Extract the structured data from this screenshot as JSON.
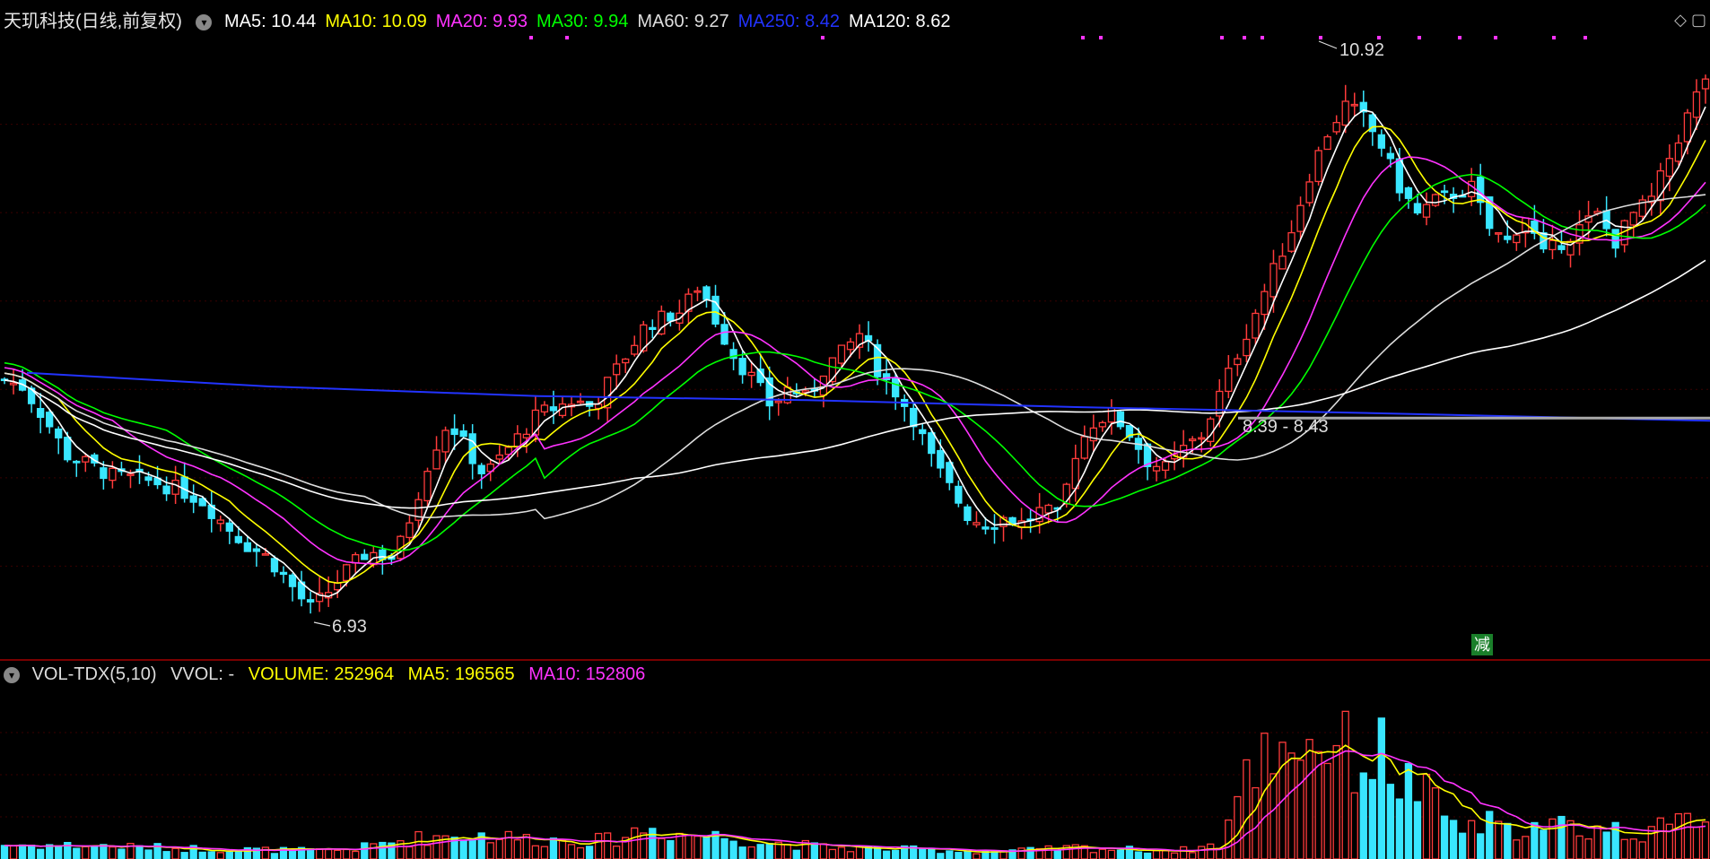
{
  "header": {
    "stock_title": "天玑科技(日线,前复权)",
    "ma_legend": [
      {
        "label": "MA5: 10.44",
        "color": "#ffffff"
      },
      {
        "label": "MA10: 10.09",
        "color": "#ffff00"
      },
      {
        "label": "MA20: 9.93",
        "color": "#ff33ff"
      },
      {
        "label": "MA30: 9.94",
        "color": "#00ff00"
      },
      {
        "label": "MA60: 9.27",
        "color": "#dddddd"
      },
      {
        "label": "MA250: 8.42",
        "color": "#2233ff"
      },
      {
        "label": "MA120: 8.62",
        "color": "#ffffff"
      }
    ]
  },
  "vol_header": {
    "indicator": "VOL-TDX(5,10)",
    "vvol": "VVOL: -",
    "volume": "VOLUME: 252964",
    "ma5": "MA5: 196565",
    "ma10": "MA10: 152806",
    "colors": {
      "indicator": "#dddddd",
      "volume": "#ffff00",
      "ma5": "#ffff00",
      "ma10": "#ff33ff"
    }
  },
  "annotations": {
    "high": "10.92",
    "low": "6.93",
    "range": "8.39 - 8.43",
    "badge": "减"
  },
  "colors": {
    "up": "#ff3b3b",
    "down": "#39e6ff",
    "ma5": "#ffffff",
    "ma10": "#ffff00",
    "ma20": "#ff33ff",
    "ma30": "#00ff00",
    "ma60": "#dddddd",
    "ma250": "#2233ff",
    "ma120": "#ffffff"
  },
  "chart_data": {
    "type": "candlestick",
    "y_range_price": [
      6.6,
      11.1
    ],
    "price_points": [
      [
        0,
        8.61
      ],
      [
        25,
        8.55
      ],
      [
        50,
        8.32
      ],
      [
        75,
        8.05
      ],
      [
        100,
        7.98
      ],
      [
        125,
        7.9
      ],
      [
        150,
        7.88
      ],
      [
        175,
        7.85
      ],
      [
        200,
        7.8
      ],
      [
        225,
        7.72
      ],
      [
        250,
        7.55
      ],
      [
        275,
        7.4
      ],
      [
        300,
        7.3
      ],
      [
        325,
        7.1
      ],
      [
        345,
        6.93
      ],
      [
        365,
        7.05
      ],
      [
        385,
        7.2
      ],
      [
        410,
        7.35
      ],
      [
        440,
        7.3
      ],
      [
        460,
        7.65
      ],
      [
        480,
        8.05
      ],
      [
        500,
        8.3
      ],
      [
        520,
        8.1
      ],
      [
        540,
        7.9
      ],
      [
        560,
        8.05
      ],
      [
        580,
        8.2
      ],
      [
        600,
        8.35
      ],
      [
        620,
        8.4
      ],
      [
        640,
        8.45
      ],
      [
        660,
        8.4
      ],
      [
        680,
        8.6
      ],
      [
        700,
        8.8
      ],
      [
        720,
        9.0
      ],
      [
        740,
        9.05
      ],
      [
        760,
        9.1
      ],
      [
        780,
        9.3
      ],
      [
        800,
        9.0
      ],
      [
        820,
        8.75
      ],
      [
        840,
        8.6
      ],
      [
        860,
        8.4
      ],
      [
        880,
        8.55
      ],
      [
        900,
        8.45
      ],
      [
        920,
        8.7
      ],
      [
        940,
        8.8
      ],
      [
        960,
        8.95
      ],
      [
        980,
        8.65
      ],
      [
        1000,
        8.5
      ],
      [
        1020,
        8.3
      ],
      [
        1040,
        8.0
      ],
      [
        1060,
        7.8
      ],
      [
        1080,
        7.6
      ],
      [
        1100,
        7.55
      ],
      [
        1120,
        7.6
      ],
      [
        1140,
        7.55
      ],
      [
        1160,
        7.65
      ],
      [
        1180,
        7.6
      ],
      [
        1200,
        8.1
      ],
      [
        1220,
        8.3
      ],
      [
        1240,
        8.35
      ],
      [
        1260,
        8.2
      ],
      [
        1280,
        8.0
      ],
      [
        1300,
        7.95
      ],
      [
        1320,
        8.1
      ],
      [
        1340,
        8.2
      ],
      [
        1360,
        8.5
      ],
      [
        1380,
        8.8
      ],
      [
        1400,
        9.1
      ],
      [
        1420,
        9.4
      ],
      [
        1440,
        9.7
      ],
      [
        1460,
        10.1
      ],
      [
        1480,
        10.4
      ],
      [
        1500,
        10.6
      ],
      [
        1520,
        10.5
      ],
      [
        1540,
        10.3
      ],
      [
        1560,
        10.0
      ],
      [
        1580,
        9.8
      ],
      [
        1600,
        9.9
      ],
      [
        1620,
        9.95
      ],
      [
        1640,
        10.0
      ],
      [
        1660,
        9.7
      ],
      [
        1680,
        9.6
      ],
      [
        1700,
        9.8
      ],
      [
        1720,
        9.5
      ],
      [
        1740,
        9.6
      ],
      [
        1760,
        9.7
      ],
      [
        1780,
        9.8
      ],
      [
        1800,
        9.6
      ],
      [
        1820,
        9.8
      ],
      [
        1840,
        9.9
      ],
      [
        1860,
        10.2
      ],
      [
        1880,
        10.5
      ],
      [
        1900,
        10.8
      ]
    ],
    "volume_points": [
      [
        0,
        16000
      ],
      [
        100,
        15000
      ],
      [
        200,
        12000
      ],
      [
        300,
        10000
      ],
      [
        360,
        9000
      ],
      [
        400,
        12000
      ],
      [
        440,
        20000
      ],
      [
        480,
        25000
      ],
      [
        520,
        28000
      ],
      [
        560,
        25000
      ],
      [
        600,
        22000
      ],
      [
        640,
        21000
      ],
      [
        680,
        21000
      ],
      [
        720,
        35000
      ],
      [
        760,
        28000
      ],
      [
        800,
        26000
      ],
      [
        840,
        20000
      ],
      [
        880,
        17000
      ],
      [
        920,
        13000
      ],
      [
        960,
        12000
      ],
      [
        1000,
        11000
      ],
      [
        1040,
        10000
      ],
      [
        1080,
        9000
      ],
      [
        1120,
        9000
      ],
      [
        1160,
        10000
      ],
      [
        1200,
        13000
      ],
      [
        1240,
        11000
      ],
      [
        1280,
        10000
      ],
      [
        1320,
        10000
      ],
      [
        1360,
        17000
      ],
      [
        1380,
        70000
      ],
      [
        1400,
        110000
      ],
      [
        1420,
        130000
      ],
      [
        1440,
        140000
      ],
      [
        1460,
        130000
      ],
      [
        1480,
        140000
      ],
      [
        1500,
        120000
      ],
      [
        1520,
        110000
      ],
      [
        1540,
        120000
      ],
      [
        1560,
        90000
      ],
      [
        1580,
        80000
      ],
      [
        1600,
        60000
      ],
      [
        1620,
        40000
      ],
      [
        1640,
        32000
      ],
      [
        1660,
        40000
      ],
      [
        1680,
        30000
      ],
      [
        1700,
        40000
      ],
      [
        1720,
        30000
      ],
      [
        1740,
        40000
      ],
      [
        1760,
        32000
      ],
      [
        1780,
        35000
      ],
      [
        1800,
        33000
      ],
      [
        1820,
        28000
      ],
      [
        1840,
        35000
      ],
      [
        1860,
        32000
      ],
      [
        1880,
        45000
      ],
      [
        1900,
        55000
      ]
    ],
    "y_range_volume": [
      0,
      190000
    ],
    "ma_series": [
      {
        "name": "MA5",
        "color": "#ffffff",
        "shift": 0,
        "smooth": 3
      },
      {
        "name": "MA10",
        "color": "#ffff00",
        "shift": 0.1,
        "smooth": 6
      },
      {
        "name": "MA20",
        "color": "#ff33ff",
        "shift": 0.18,
        "smooth": 12
      },
      {
        "name": "MA30",
        "color": "#00ff00",
        "shift": 0.25,
        "smooth": 18
      },
      {
        "name": "MA60",
        "color": "#dddddd",
        "shift": 0.1,
        "smooth": 40
      },
      {
        "name": "MA120",
        "color": "#ffffff",
        "shift": 0.0,
        "smooth": 70
      }
    ],
    "ma250_line": [
      [
        30,
        8.65
      ],
      [
        300,
        8.55
      ],
      [
        600,
        8.48
      ],
      [
        900,
        8.45
      ],
      [
        1200,
        8.4
      ],
      [
        1500,
        8.36
      ],
      [
        1906,
        8.3
      ]
    ],
    "flat_line_price": 8.32
  }
}
